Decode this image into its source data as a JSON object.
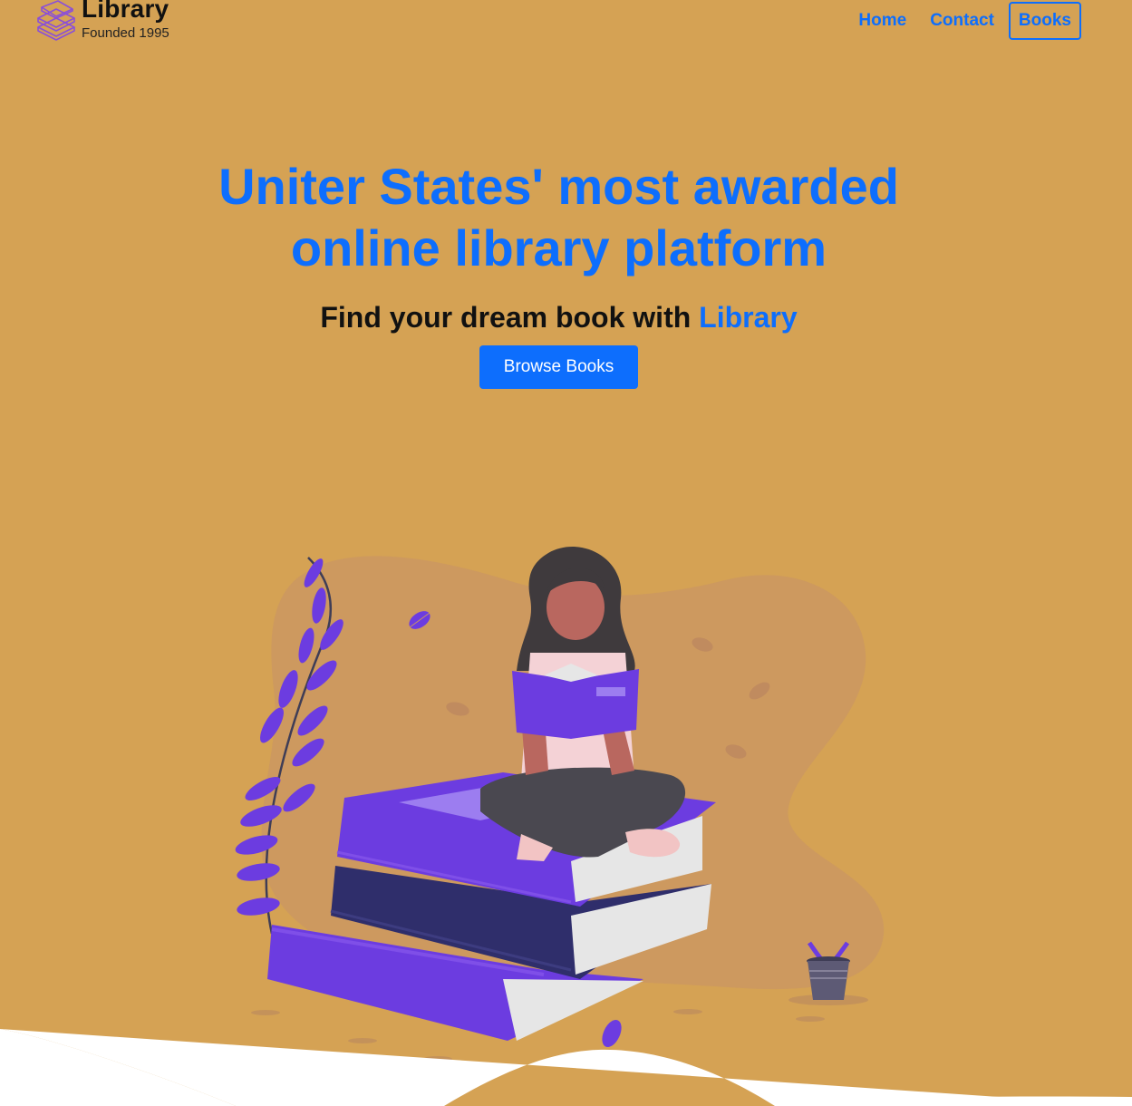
{
  "brand": {
    "title": "Library",
    "subtitle": "Founded 1995",
    "logo_icon": "book-stack-icon",
    "accent_color": "#0d6efd",
    "background_color": "#d5a254"
  },
  "nav": {
    "items": [
      {
        "label": "Home",
        "active": false
      },
      {
        "label": "Contact",
        "active": false
      },
      {
        "label": "Books",
        "active": true
      }
    ]
  },
  "hero": {
    "title_line1": "Uniter States' most awarded",
    "title_line2": "online library platform",
    "subtitle_prefix": "Find your dream book with ",
    "subtitle_brand": "Library",
    "cta_label": "Browse Books"
  },
  "illustration": {
    "subject": "woman-reading-on-books-illustration",
    "icons": [
      "leaf-icon",
      "plant-pot-icon",
      "fern-icon"
    ]
  }
}
